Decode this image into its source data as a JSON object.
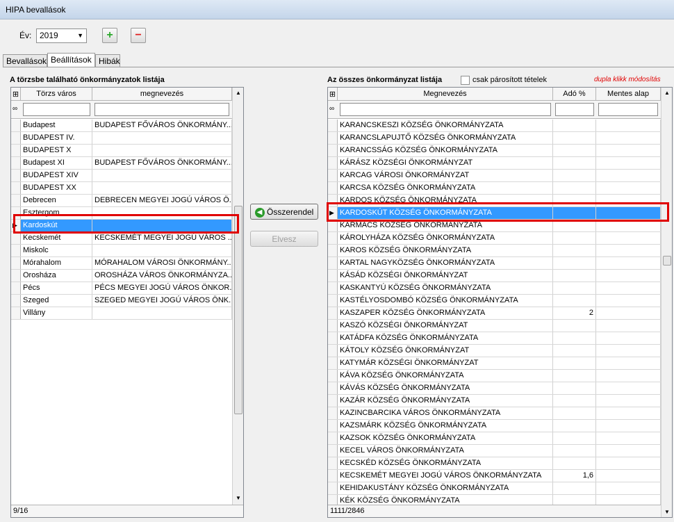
{
  "window": {
    "title": "HIPA bevallások"
  },
  "toolbar": {
    "year_label": "Év:",
    "year_value": "2019",
    "add_symbol": "+",
    "remove_symbol": "−"
  },
  "tabs": [
    {
      "label": "Bevallások"
    },
    {
      "label": "Beállítások"
    },
    {
      "label": "Hibák"
    }
  ],
  "left": {
    "heading": "A törzsbe található önkormányzatok listája",
    "columns": [
      "Törzs város",
      "megnevezés"
    ],
    "rows": [
      {
        "city": "Budapest",
        "name": "BUDAPEST FŐVÁROS ÖNKORMÁNY..."
      },
      {
        "city": "BUDAPEST IV.",
        "name": ""
      },
      {
        "city": "BUDAPEST X",
        "name": ""
      },
      {
        "city": "Budapest XI",
        "name": "BUDAPEST FŐVÁROS ÖNKORMÁNY..."
      },
      {
        "city": "BUDAPEST XIV",
        "name": ""
      },
      {
        "city": "BUDAPEST XX",
        "name": ""
      },
      {
        "city": "Debrecen",
        "name": "DEBRECEN MEGYEI JOGÚ VÁROS Ö..."
      },
      {
        "city": "Esztergom",
        "name": ""
      },
      {
        "city": "Kardoskút",
        "name": ""
      },
      {
        "city": "Kecskemét",
        "name": "KECSKEMÉT MEGYEI JOGÚ VÁROS ..."
      },
      {
        "city": "Miskolc",
        "name": ""
      },
      {
        "city": "Mórahalom",
        "name": "MÓRAHALOM VÁROSI ÖNKORMÁNY..."
      },
      {
        "city": "Orosháza",
        "name": "OROSHÁZA VÁROS ÖNKORMÁNYZA..."
      },
      {
        "city": "Pécs",
        "name": "PÉCS MEGYEI JOGÚ VÁROS ÖNKOR..."
      },
      {
        "city": "Szeged",
        "name": "SZEGED MEGYEI JOGÚ VÁROS ÖNK..."
      },
      {
        "city": "Villány",
        "name": ""
      }
    ],
    "status": "9/16"
  },
  "buttons": {
    "assign": "Összerendel",
    "remove": "Elvesz"
  },
  "right": {
    "heading": "Az összes önkormányzat listája",
    "checkbox_label": "csak párosított tételek",
    "hint": "dupla klikk módosítás",
    "columns": [
      "Megnevezés",
      "Adó %",
      "Mentes alap"
    ],
    "rows": [
      {
        "name": "KARANCSKESZI KÖZSÉG ÖNKORMÁNYZATA",
        "tax": "",
        "exempt": ""
      },
      {
        "name": "KARANCSLAPUJTŐ KÖZSÉG ÖNKORMÁNYZATA",
        "tax": "",
        "exempt": ""
      },
      {
        "name": "KARANCSSÁG KÖZSÉG ÖNKORMÁNYZATA",
        "tax": "",
        "exempt": ""
      },
      {
        "name": "KÁRÁSZ KÖZSÉGI ÖNKORMÁNYZAT",
        "tax": "",
        "exempt": ""
      },
      {
        "name": "KARCAG VÁROSI ÖNKORMÁNYZAT",
        "tax": "",
        "exempt": ""
      },
      {
        "name": "KARCSA KÖZSÉG ÖNKORMÁNYZATA",
        "tax": "",
        "exempt": ""
      },
      {
        "name": "KARDOS KÖZSÉG ÖNKORMÁNYZATA",
        "tax": "",
        "exempt": ""
      },
      {
        "name": "KARDOSKÚT KÖZSÉG ÖNKORMÁNYZATA",
        "tax": "",
        "exempt": ""
      },
      {
        "name": "KARMACS KÖZSÉG ÖNKORMÁNYZATA",
        "tax": "",
        "exempt": ""
      },
      {
        "name": "KÁROLYHÁZA KÖZSÉG ÖNKORMÁNYZATA",
        "tax": "",
        "exempt": ""
      },
      {
        "name": "KAROS KÖZSÉG ÖNKORMÁNYZATA",
        "tax": "",
        "exempt": ""
      },
      {
        "name": "KARTAL NAGYKÖZSÉG ÖNKORMÁNYZATA",
        "tax": "",
        "exempt": ""
      },
      {
        "name": "KÁSÁD KÖZSÉGI ÖNKORMÁNYZAT",
        "tax": "",
        "exempt": ""
      },
      {
        "name": "KASKANTYÚ KÖZSÉG ÖNKORMÁNYZATA",
        "tax": "",
        "exempt": ""
      },
      {
        "name": "KASTÉLYOSDOMBÓ KÖZSÉG ÖNKORMÁNYZATA",
        "tax": "",
        "exempt": ""
      },
      {
        "name": "KASZAPER KÖZSÉG ÖNKORMÁNYZATA",
        "tax": "2",
        "exempt": ""
      },
      {
        "name": "KASZÓ KÖZSÉGI ÖNKORMÁNYZAT",
        "tax": "",
        "exempt": ""
      },
      {
        "name": "KATÁDFA KÖZSÉG ÖNKORMÁNYZATA",
        "tax": "",
        "exempt": ""
      },
      {
        "name": "KÁTOLY KÖZSÉG ÖNKORMÁNYZAT",
        "tax": "",
        "exempt": ""
      },
      {
        "name": "KATYMÁR KÖZSÉGI ÖNKORMÁNYZAT",
        "tax": "",
        "exempt": ""
      },
      {
        "name": "KÁVA KÖZSÉG ÖNKORMÁNYZATA",
        "tax": "",
        "exempt": ""
      },
      {
        "name": "KÁVÁS KÖZSÉG ÖNKORMÁNYZATA",
        "tax": "",
        "exempt": ""
      },
      {
        "name": "KAZÁR KÖZSÉG ÖNKORMÁNYZATA",
        "tax": "",
        "exempt": ""
      },
      {
        "name": "KAZINCBARCIKA VÁROS ÖNKORMÁNYZATA",
        "tax": "",
        "exempt": ""
      },
      {
        "name": "KAZSMÁRK KÖZSÉG ÖNKORMÁNYZATA",
        "tax": "",
        "exempt": ""
      },
      {
        "name": "KAZSOK KÖZSÉG ÖNKORMÁNYZATA",
        "tax": "",
        "exempt": ""
      },
      {
        "name": "KECEL VÁROS ÖNKORMÁNYZATA",
        "tax": "",
        "exempt": ""
      },
      {
        "name": "KECSKÉD KÖZSÉG ÖNKORMÁNYZATA",
        "tax": "",
        "exempt": ""
      },
      {
        "name": "KECSKEMÉT MEGYEI JOGÚ VÁROS ÖNKORMÁNYZATA",
        "tax": "1,6",
        "exempt": ""
      },
      {
        "name": "KEHIDAKUSTÁNY KÖZSÉG ÖNKORMÁNYZATA",
        "tax": "",
        "exempt": ""
      },
      {
        "name": "KÉK KÖZSÉG ÖNKORMÁNYZATA",
        "tax": "",
        "exempt": ""
      }
    ],
    "status": "1111/2846"
  },
  "colors": {
    "selection": "#3399ff",
    "highlight": "#e00000"
  }
}
